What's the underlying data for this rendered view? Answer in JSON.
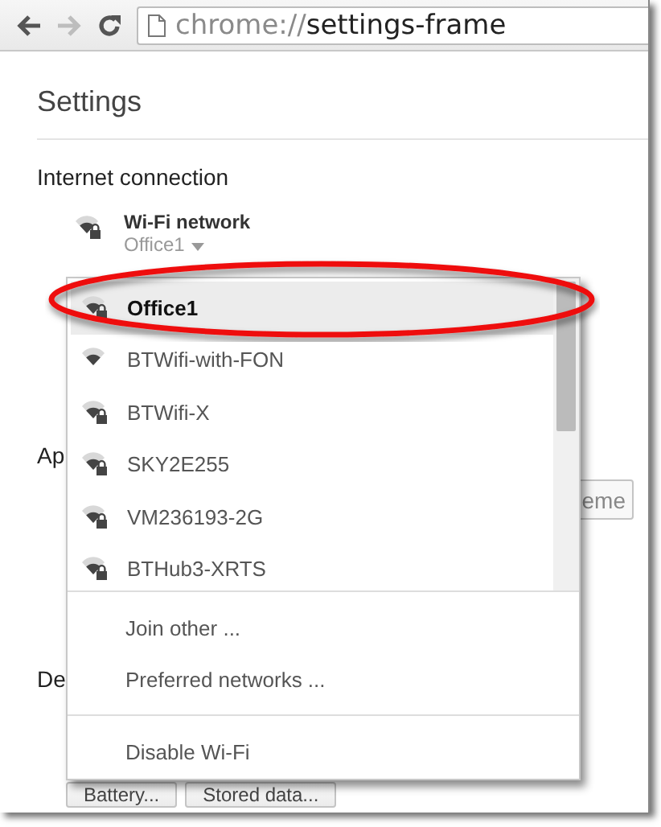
{
  "toolbar": {
    "url_scheme": "chrome://",
    "url_path": "settings-frame",
    "forward_disabled": true
  },
  "settings": {
    "title": "Settings",
    "section": "Internet connection",
    "network": {
      "label": "Wi-Fi network",
      "value": "Office1"
    },
    "appearance_heading": "Ap",
    "theme_button": "eme",
    "device_heading": "De",
    "device_buttons": [
      "Battery...",
      "Stored data..."
    ]
  },
  "network_menu": {
    "networks": [
      {
        "name": "Office1",
        "locked": true,
        "selected": true
      },
      {
        "name": "BTWifi-with-FON",
        "locked": false,
        "selected": false
      },
      {
        "name": "BTWifi-X",
        "locked": true,
        "selected": false
      },
      {
        "name": "SKY2E255",
        "locked": true,
        "selected": false
      },
      {
        "name": "VM236193-2G",
        "locked": true,
        "selected": false
      },
      {
        "name": "BTHub3-XRTS",
        "locked": true,
        "selected": false
      }
    ],
    "actions": [
      "Join other ...",
      "Preferred networks ..."
    ],
    "footer_actions": [
      "Disable Wi-Fi"
    ]
  }
}
